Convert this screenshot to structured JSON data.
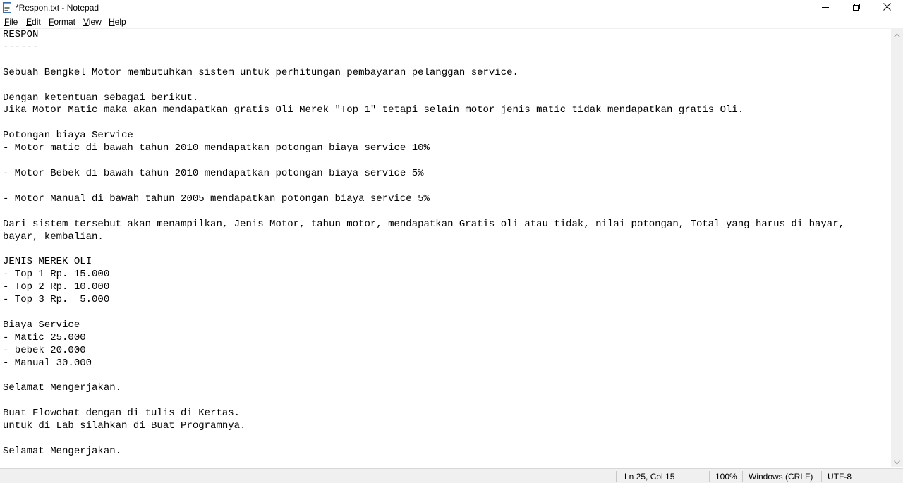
{
  "window": {
    "title": "*Respon.txt - Notepad",
    "controls": {
      "minimize_icon": "minimize-icon",
      "restore_icon": "restore-icon",
      "close_icon": "close-icon"
    }
  },
  "menu": {
    "file": {
      "access": "F",
      "rest": "ile"
    },
    "edit": {
      "access": "E",
      "rest": "dit"
    },
    "format": {
      "access": "F",
      "rest": "ormat"
    },
    "view": {
      "access": "V",
      "rest": "iew"
    },
    "help": {
      "access": "H",
      "rest": "elp"
    }
  },
  "editor": {
    "content": "RESPON\n------\n\nSebuah Bengkel Motor membutuhkan sistem untuk perhitungan pembayaran pelanggan service.\n\nDengan ketentuan sebagai berikut.\nJika Motor Matic maka akan mendapatkan gratis Oli Merek \"Top 1\" tetapi selain motor jenis matic tidak mendapatkan gratis Oli.\n\nPotongan biaya Service\n- Motor matic di bawah tahun 2010 mendapatkan potongan biaya service 10%\n\n- Motor Bebek di bawah tahun 2010 mendapatkan potongan biaya service 5%\n\n- Motor Manual di bawah tahun 2005 mendapatkan potongan biaya service 5%\n\nDari sistem tersebut akan menampilkan, Jenis Motor, tahun motor, mendapatkan Gratis oli atau tidak, nilai potongan, Total yang harus di bayar,\nbayar, kembalian.\n\nJENIS MEREK OLI\n- Top 1 Rp. 15.000\n- Top 2 Rp. 10.000\n- Top 3 Rp.  5.000\n\nBiaya Service\n- Matic 25.000\n- bebek 20.000\n- Manual 30.000\n\nSelamat Mengerjakan.\n\nBuat Flowchat dengan di tulis di Kertas.\nuntuk di Lab silahkan di Buat Programnya.\n\nSelamat Mengerjakan."
  },
  "statusbar": {
    "position": "Ln 25, Col 15",
    "zoom": "100%",
    "line_ending": "Windows (CRLF)",
    "encoding": "UTF-8"
  }
}
